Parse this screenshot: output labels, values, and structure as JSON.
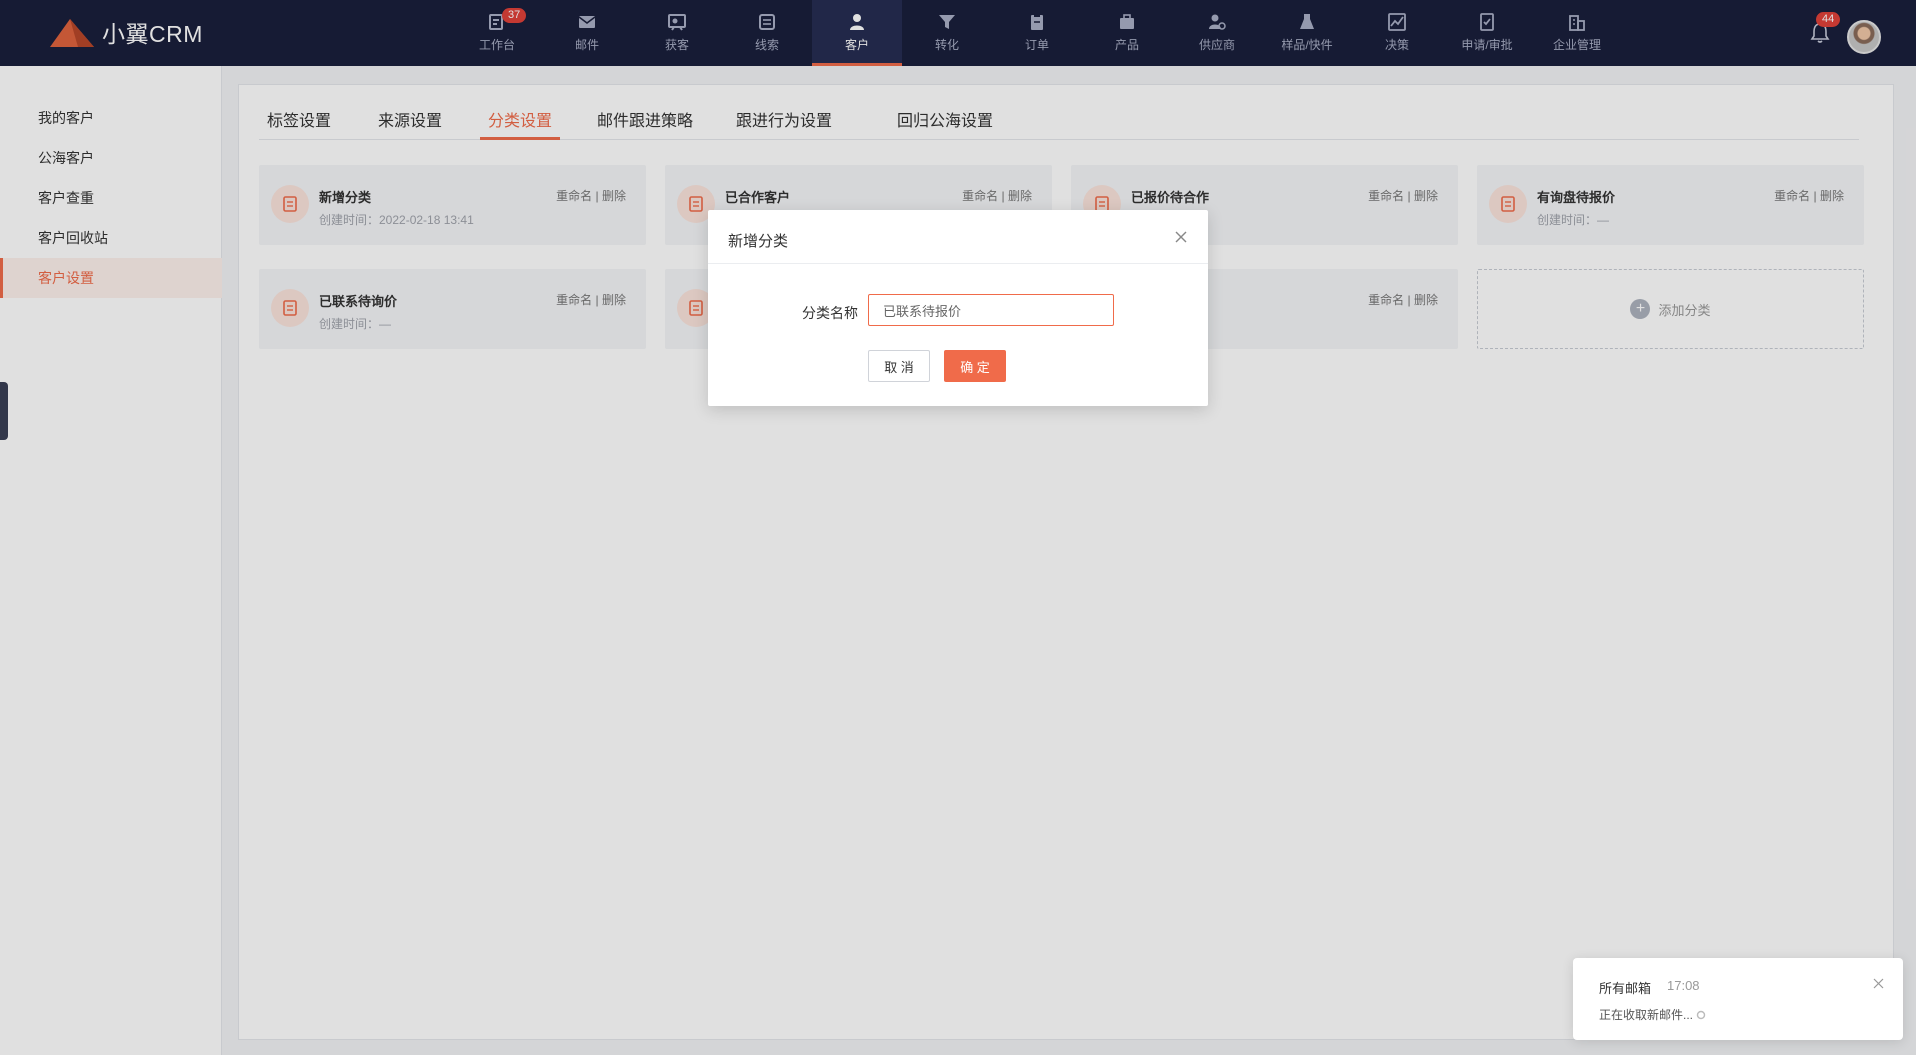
{
  "app": {
    "logo_text": "小翼CRM"
  },
  "nav": {
    "items": [
      {
        "label": "工作台",
        "icon": "dashboard-icon",
        "badge": "37"
      },
      {
        "label": "邮件",
        "icon": "mail-icon"
      },
      {
        "label": "获客",
        "icon": "acquire-icon"
      },
      {
        "label": "线索",
        "icon": "leads-icon"
      },
      {
        "label": "客户",
        "icon": "customer-icon",
        "active": true
      },
      {
        "label": "转化",
        "icon": "funnel-icon"
      },
      {
        "label": "订单",
        "icon": "order-icon"
      },
      {
        "label": "产品",
        "icon": "product-icon"
      },
      {
        "label": "供应商",
        "icon": "supplier-icon"
      },
      {
        "label": "样品/快件",
        "icon": "sample-icon"
      },
      {
        "label": "决策",
        "icon": "chart-icon"
      },
      {
        "label": "申请/审批",
        "icon": "approval-icon"
      },
      {
        "label": "企业管理",
        "icon": "building-icon"
      }
    ],
    "bell_badge": "44"
  },
  "sidebar": {
    "items": [
      {
        "label": "我的客户"
      },
      {
        "label": "公海客户"
      },
      {
        "label": "客户查重"
      },
      {
        "label": "客户回收站"
      },
      {
        "label": "客户设置",
        "active": true
      }
    ]
  },
  "tabs": [
    {
      "label": "标签设置"
    },
    {
      "label": "来源设置"
    },
    {
      "label": "分类设置",
      "active": true
    },
    {
      "label": "邮件跟进策略"
    },
    {
      "label": "跟进行为设置"
    },
    {
      "label": "回归公海设置"
    }
  ],
  "card_actions": {
    "rename": "重命名",
    "separator": " | ",
    "delete": "删除"
  },
  "categories": [
    {
      "name": "新增分类",
      "created": "创建时间：2022-02-18 13:41"
    },
    {
      "name": "已合作客户",
      "created": ""
    },
    {
      "name": "已报价待合作",
      "created": ""
    },
    {
      "name": "有询盘待报价",
      "created": "创建时间：—"
    },
    {
      "name": "已联系待询价",
      "created": "创建时间：—"
    }
  ],
  "add_category_label": "添加分类",
  "modal": {
    "title": "新增分类",
    "field_label": "分类名称",
    "field_value": "已联系待报价",
    "cancel_label": "取 消",
    "ok_label": "确 定"
  },
  "toast": {
    "title": "所有邮箱",
    "time": "17:08",
    "body": "正在收取新邮件..."
  },
  "colors": {
    "accent": "#f06b4a",
    "nav_bg": "#1a1f3c",
    "badge": "#e0413a"
  }
}
